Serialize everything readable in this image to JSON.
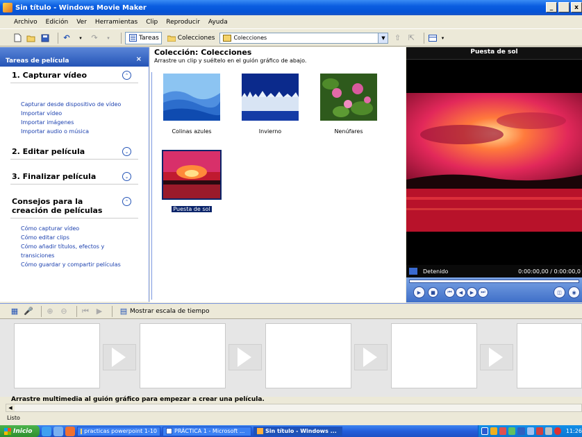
{
  "window": {
    "title": "Sin título - Windows Movie Maker",
    "controls": [
      "_",
      " ",
      "x"
    ]
  },
  "menu": [
    "Archivo",
    "Edición",
    "Ver",
    "Herramientas",
    "Clip",
    "Reproducir",
    "Ayuda"
  ],
  "toolbar": {
    "tasks_label": "Tareas",
    "collections_label": "Colecciones",
    "combo_value": "Colecciones"
  },
  "taskpane": {
    "header": "Tareas de película",
    "close": "×",
    "sections": [
      {
        "title": "1. Capturar vídeo",
        "expanded": true,
        "links": [
          "Capturar desde dispositivo de vídeo",
          "Importar vídeo",
          "Importar imágenes",
          "Importar audio o música"
        ]
      },
      {
        "title": "2. Editar película",
        "expanded": false
      },
      {
        "title": "3. Finalizar película",
        "expanded": false
      },
      {
        "title": "Consejos para la creación de películas",
        "expanded": true,
        "links": [
          "Cómo capturar vídeo",
          "Cómo editar clips",
          "Cómo añadir títulos, efectos y transiciones",
          "Cómo guardar y compartir películas"
        ]
      }
    ]
  },
  "collection": {
    "title": "Colección: Colecciones",
    "subtitle": "Arrastre un clip y suéltelo en el guión gráfico de abajo.",
    "clips": [
      {
        "label": "Colinas azules",
        "selected": false
      },
      {
        "label": "Invierno",
        "selected": false
      },
      {
        "label": "Nenúfares",
        "selected": false
      },
      {
        "label": "Puesta de sol",
        "selected": true
      }
    ]
  },
  "preview": {
    "title": "Puesta de sol",
    "status": "Detenido",
    "time": "0:00:00,00 / 0:00:00,0"
  },
  "timeline_toolbar": {
    "show_timeline": "Mostrar escala de tiempo"
  },
  "storyboard": {
    "message": "Arrastre multimedia al guión gráfico para empezar a crear una película."
  },
  "statusbar": {
    "text": "Listo"
  },
  "taskbar": {
    "start": "Inicio",
    "items": [
      {
        "label": "practicas powerpoint 1-10",
        "active": false
      },
      {
        "label": "PRÁCTICA 1 - Microsoft ...",
        "active": false
      },
      {
        "label": "Sin título - Windows ...",
        "active": true
      }
    ],
    "clock": "11:26"
  },
  "colors": {
    "title_bar": "#0553d6",
    "link": "#1a3fae",
    "taskbar": "#245edb",
    "start_button": "#2f8f2f"
  }
}
